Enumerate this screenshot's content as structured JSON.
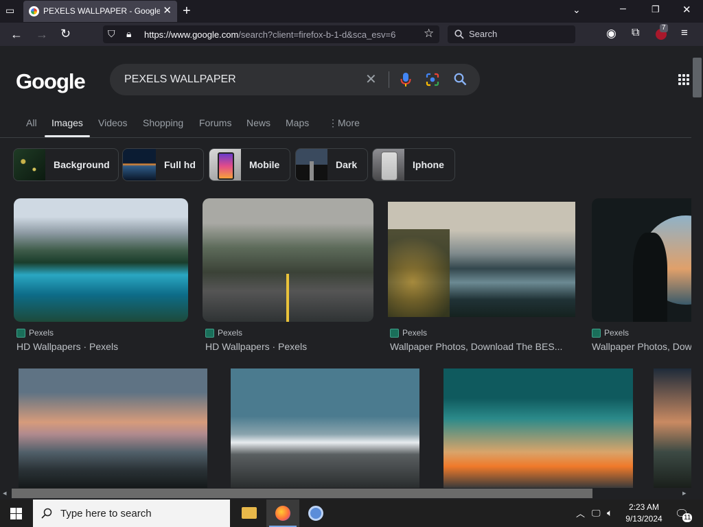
{
  "browser": {
    "tab_title": "PEXELS WALLPAPER - Google Search",
    "url_host": "https://www.google.com",
    "url_rest": "/search?client=firefox-b-1-d&sca_esv=6",
    "search_placeholder": "Search",
    "badge_count": "7"
  },
  "google": {
    "logo": "Google",
    "query": "PEXELS WALLPAPER",
    "tabs": [
      "All",
      "Images",
      "Videos",
      "Shopping",
      "Forums",
      "News",
      "Maps",
      "More"
    ],
    "active_tab": "Images",
    "chips": [
      "Background",
      "Full hd",
      "Mobile",
      "Dark",
      "Iphone"
    ]
  },
  "results": [
    {
      "source": "Pexels",
      "caption": "HD Wallpapers · Pexels"
    },
    {
      "source": "Pexels",
      "caption": "HD Wallpapers · Pexels"
    },
    {
      "source": "Pexels",
      "caption": "Wallpaper Photos, Download The BES..."
    },
    {
      "source": "Pexels",
      "caption": "Wallpaper Photos, Dow"
    }
  ],
  "taskbar": {
    "search_placeholder": "Type here to search",
    "time": "2:23 AM",
    "date": "9/13/2024",
    "notification_count": "11"
  },
  "colors": {
    "accent": "#8ab4f8",
    "page_bg": "#202124",
    "chrome_bg": "#2b2a33"
  }
}
